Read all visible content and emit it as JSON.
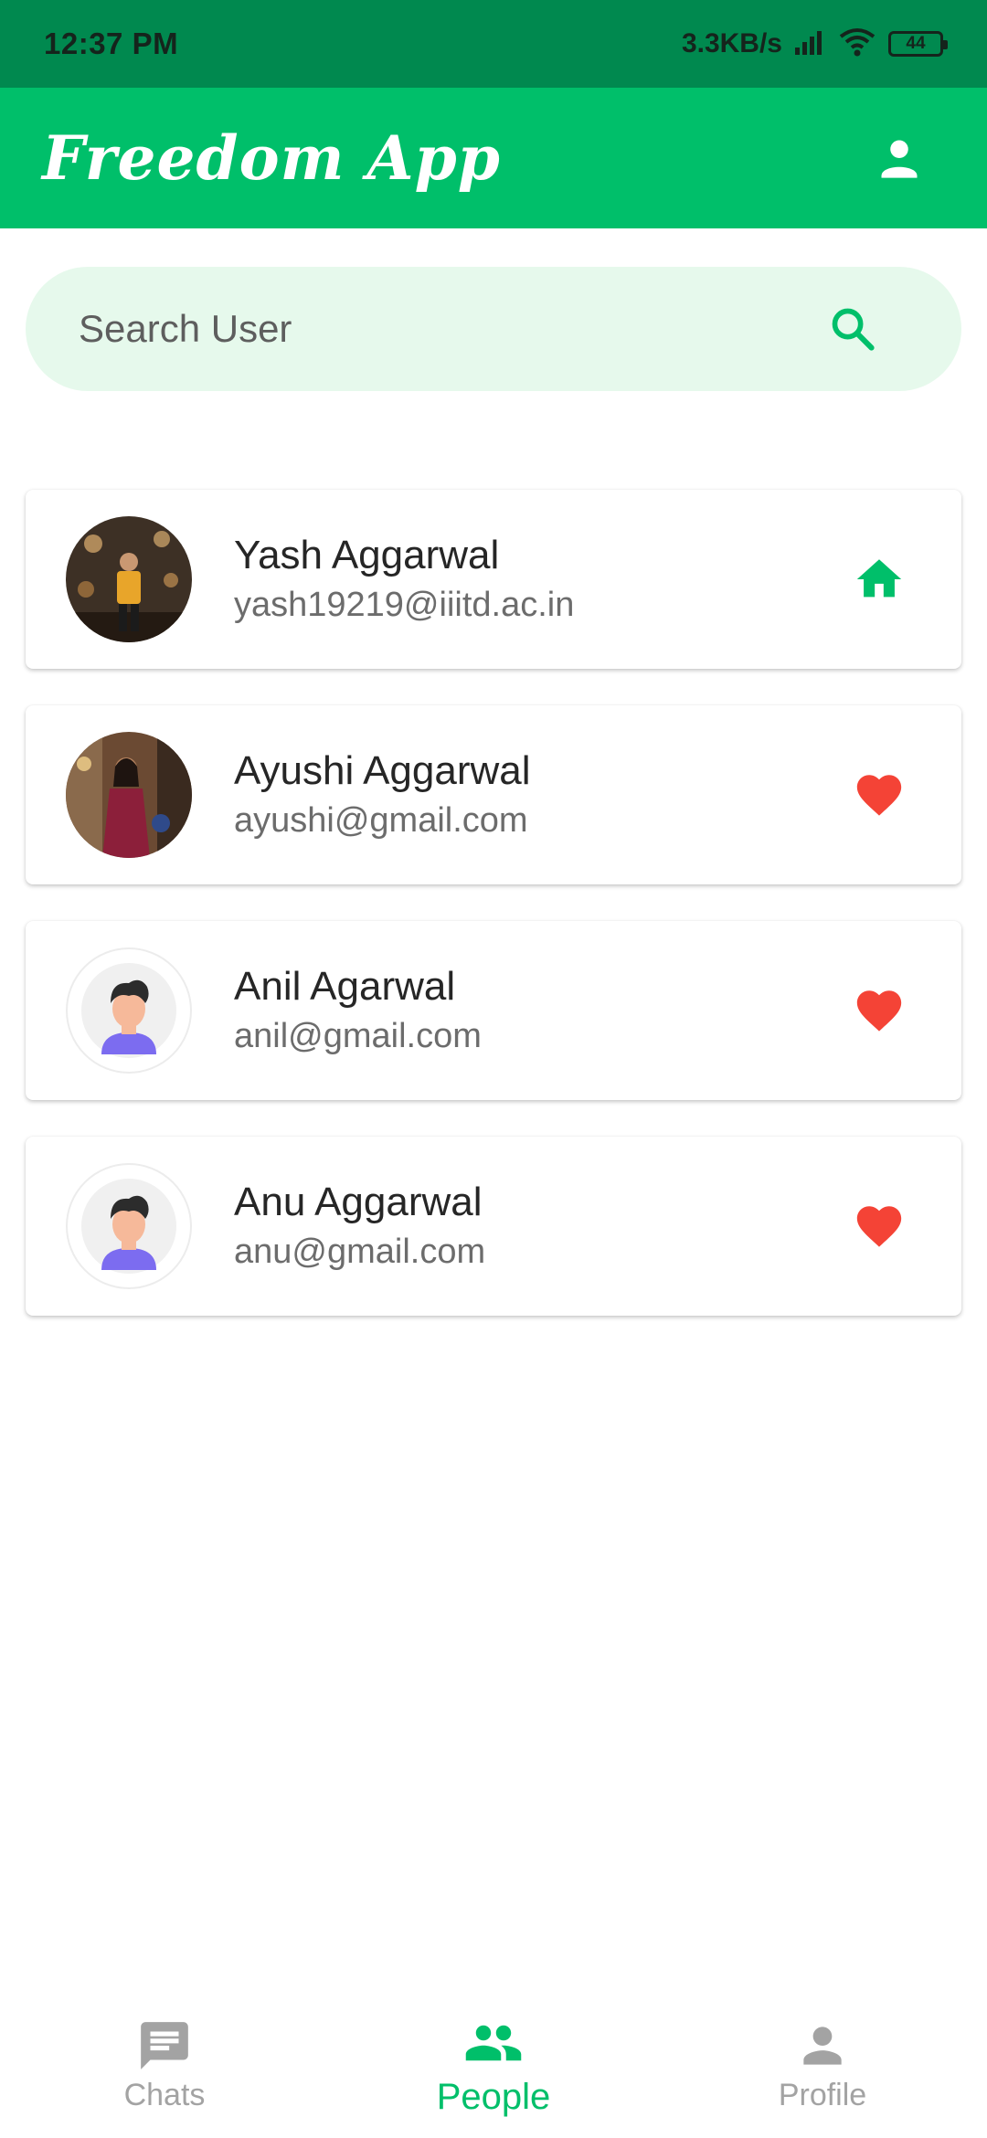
{
  "status_bar": {
    "time": "12:37 PM",
    "speed": "3.3KB/s",
    "battery": "44"
  },
  "app_bar": {
    "title": "Freedom App",
    "profile_icon": "person-icon"
  },
  "search": {
    "placeholder": "Search User",
    "icon": "search-icon"
  },
  "users": [
    {
      "name": "Yash Aggarwal",
      "email": "yash19219@iiitd.ac.in",
      "status_icon": "home-icon"
    },
    {
      "name": "Ayushi Aggarwal",
      "email": "ayushi@gmail.com",
      "status_icon": "heart-icon"
    },
    {
      "name": "Anil Agarwal",
      "email": "anil@gmail.com",
      "status_icon": "heart-icon"
    },
    {
      "name": "Anu Aggarwal",
      "email": "anu@gmail.com",
      "status_icon": "heart-icon"
    }
  ],
  "bottom_nav": {
    "items": [
      {
        "label": "Chats",
        "icon": "chat-icon",
        "active": false
      },
      {
        "label": "People",
        "icon": "people-icon",
        "active": true
      },
      {
        "label": "Profile",
        "icon": "person-icon",
        "active": false
      }
    ]
  },
  "colors": {
    "status_bar": "#00894f",
    "primary": "#00bf6a",
    "search_bg": "#e6f9ec",
    "heart": "#f44336",
    "inactive": "#a3a3a3"
  }
}
